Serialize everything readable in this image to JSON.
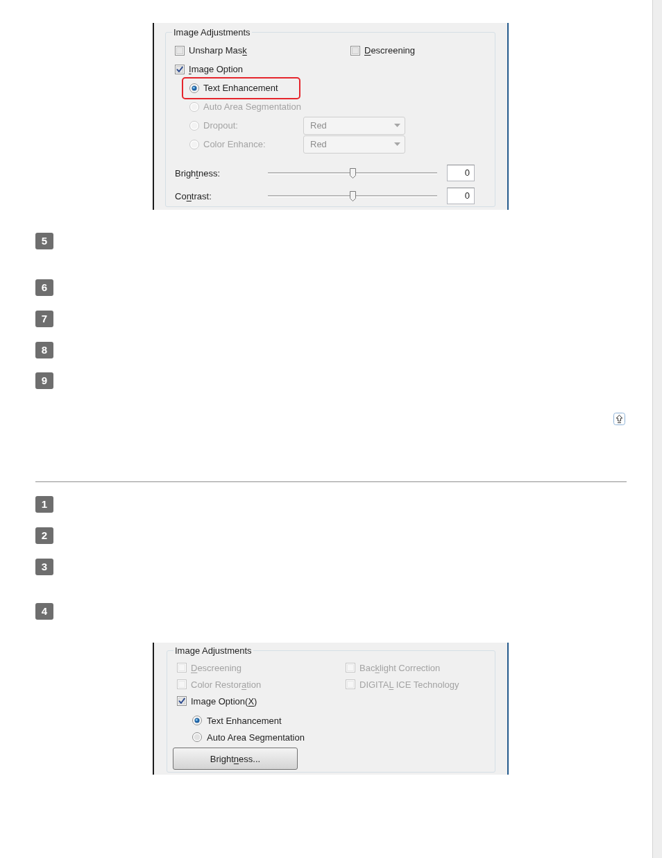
{
  "top_dialog": {
    "group_title": "Image Adjustments",
    "checkbox_rows": [
      [
        {
          "label": {
            "before": "Unsharp Mas",
            "key": "k"
          },
          "checked": false,
          "disabled": false
        },
        {
          "label": {
            "key": "D",
            "after": "escreening"
          },
          "checked": false,
          "disabled": false
        }
      ],
      [
        {
          "label": {
            "key": "I",
            "after": "mage Option"
          },
          "checked": true,
          "disabled": false
        }
      ]
    ],
    "options": [
      {
        "label": "Text Enhancement",
        "selected": true,
        "disabled": false,
        "highlighted": true
      },
      {
        "label": "Auto Area Segmentation",
        "selected": false,
        "disabled": true,
        "highlighted": false
      },
      {
        "label": "Dropout:",
        "selected": false,
        "disabled": true,
        "highlighted": false,
        "dropdown": "Red"
      },
      {
        "label": "Color Enhance:",
        "selected": false,
        "disabled": true,
        "highlighted": false,
        "dropdown": "Red"
      }
    ],
    "sliders": [
      {
        "label": {
          "before": "Brigh",
          "key": "t",
          "after": "ness:"
        },
        "level": 0.5,
        "value": "0"
      },
      {
        "label": {
          "before": "Co",
          "key": "n",
          "after": "trast:"
        },
        "level": 0.5,
        "value": "0"
      }
    ]
  },
  "steps_upper": [
    "5",
    "6",
    "7",
    "8",
    "9"
  ],
  "steps_lower": [
    "1",
    "2",
    "3",
    "4"
  ],
  "bottom_dialog": {
    "group_title": "Image Adjustments",
    "checkbox_rows": [
      [
        {
          "label": {
            "key": "D",
            "after": "escreening"
          },
          "checked": false,
          "disabled": true
        },
        {
          "label": {
            "before": "Bac",
            "key": "k",
            "after": "light Correction"
          },
          "checked": false,
          "disabled": true
        }
      ],
      [
        {
          "label": {
            "before": "Color Restor",
            "key": "a",
            "after": "tion"
          },
          "checked": false,
          "disabled": true
        },
        {
          "label": {
            "before": "DIGITA",
            "key": "L",
            "after": " ICE Technology"
          },
          "checked": false,
          "disabled": true
        }
      ],
      [
        {
          "label": {
            "before": "Image Option(",
            "key": "X",
            "after": ")"
          },
          "checked": true,
          "disabled": false
        }
      ]
    ],
    "options": [
      {
        "label": "Text Enhancement",
        "selected": true,
        "disabled": false,
        "highlighted": false
      },
      {
        "label": "Auto Area Segmentation",
        "selected": false,
        "disabled": false,
        "highlighted": false
      }
    ],
    "button": {
      "label": {
        "before": "Bright",
        "key": "n",
        "after": "ess..."
      }
    }
  }
}
